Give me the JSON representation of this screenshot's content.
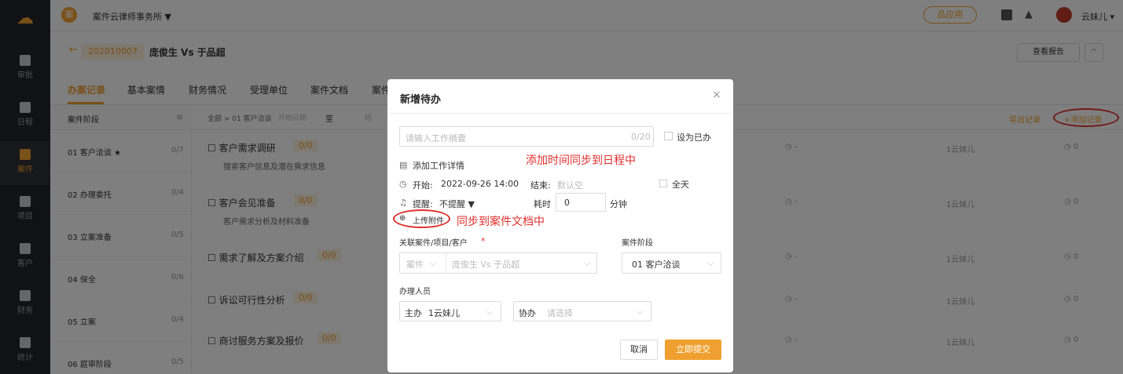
{
  "sidebar": {
    "items": [
      {
        "label": "审批"
      },
      {
        "label": "日程"
      },
      {
        "label": "案件"
      },
      {
        "label": "项目"
      },
      {
        "label": "客户"
      },
      {
        "label": "财务"
      },
      {
        "label": "统计"
      }
    ]
  },
  "topbar": {
    "firm_logo": "案",
    "firm_name": "案件云律师事务所 ▼",
    "app_button": "品应用",
    "user_name": "云妹儿 ▾"
  },
  "case": {
    "back": "←",
    "number": "202010007",
    "title": "庞俊生 Vs 于品超",
    "report_button": "查看报告",
    "collapse": "^"
  },
  "tabs": [
    "办案记录",
    "基本案情",
    "财务情况",
    "受理单位",
    "案件文档",
    "案件"
  ],
  "stages": {
    "header": "案件阶段",
    "menu_icon": "≡",
    "items": [
      {
        "name": "01 客户洽谈 ★",
        "count": "0/7"
      },
      {
        "name": "02 办理委托",
        "count": "0/4"
      },
      {
        "name": "03 立案准备",
        "count": "0/5"
      },
      {
        "name": "04 保全",
        "count": "0/6"
      },
      {
        "name": "05 立案",
        "count": "0/4"
      },
      {
        "name": "06 庭审阶段",
        "count": "0/5"
      }
    ]
  },
  "list_header": {
    "breadcrumb": "全部 > 01 客户洽谈",
    "date_start": "开始日期",
    "date_to": "至",
    "date_partial": "结",
    "export": "导出记录",
    "add": "+添加记录"
  },
  "tasks": [
    {
      "title": "☐ 客户需求调研",
      "badge": "0/0",
      "desc": "搜索客户信息及潜在需求信息",
      "time": "◷ -",
      "user": "1云妹儿",
      "count": "◷ 0"
    },
    {
      "title": "☐ 客户会见准备",
      "badge": "0/0",
      "desc": "客户需求分析及材料准备",
      "time": "◷ -",
      "user": "1云妹儿",
      "count": "◷ 0"
    },
    {
      "title": "☐ 需求了解及方案介绍",
      "badge": "0/0",
      "desc": "",
      "time": "◷ -",
      "user": "1云妹儿",
      "count": "◷ 0"
    },
    {
      "title": "☐ 诉讼可行性分析",
      "badge": "0/0",
      "desc": "",
      "time": "◷ -",
      "user": "1云妹儿",
      "count": "◷ 0"
    },
    {
      "title": "☐ 商讨服务方案及报价",
      "badge": "0/0",
      "desc": "",
      "time": "◷ -",
      "user": "1云妹儿",
      "count": "◷ 0"
    }
  ],
  "dialog": {
    "title": "新增待办",
    "close": "×",
    "summary_placeholder": "请输入工作摘要",
    "summary_count": "0/20",
    "mark_done": "设为已办",
    "add_detail": "添加工作详情",
    "start_label": "开始:",
    "start_value": "2022-09-26 14:00",
    "end_label": "结束:",
    "end_placeholder": "默认空",
    "all_day": "全天",
    "remind_label": "提醒:",
    "remind_value": "不提醒 ▼",
    "duration_label": "耗时",
    "duration_value": "0",
    "duration_unit": "分钟",
    "upload": "上传附件",
    "related_label": "关联案件/项目/客户",
    "required_mark": "*",
    "related_type": "案件",
    "related_value": "庞俊生 Vs 于品超",
    "stage_label": "案件阶段",
    "stage_value": "01 客户洽谈",
    "handler_label": "办理人员",
    "main_label": "主办",
    "main_value": "1云妹儿",
    "assist_label": "协办",
    "assist_placeholder": "请选择",
    "cancel": "取消",
    "submit": "立即提交"
  },
  "annotations": {
    "schedule_note": "添加时间同步到日程中",
    "doc_note": "同步到案件文档中"
  },
  "colors": {
    "accent": "#f0a030",
    "annotation": "#e0302c",
    "sidebar": "#23252b"
  }
}
